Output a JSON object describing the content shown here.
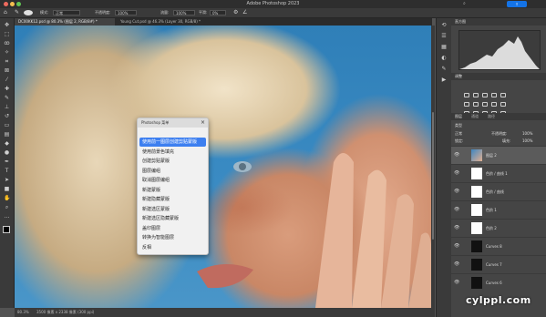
{
  "app": {
    "title": "Adobe Photoshop 2023",
    "traffic_lights": [
      "#ed6a5e",
      "#f5bf4f",
      "#62c554"
    ]
  },
  "options_bar": {
    "mode_label": "模式:",
    "mode_value": "正常",
    "opacity_label": "不透明度:",
    "opacity_value": "100%",
    "flow_label": "流量:",
    "flow_value": "100%",
    "smoothing_label": "平滑:",
    "smoothing_value": "0%"
  },
  "tabs": [
    {
      "label": "DC00KK12.psd @ 80.3% (图层 2, RGB/8#) *",
      "active": true
    },
    {
      "label": "Young Cut.psd @ 46.3% (Layer 30, RGB/8) *",
      "active": false
    }
  ],
  "toolbar": {
    "tools": [
      "move-icon",
      "marquee-icon",
      "lasso-icon",
      "quick-select-icon",
      "crop-icon",
      "frame-icon",
      "eyedropper-icon",
      "healing-icon",
      "brush-icon",
      "stamp-icon",
      "history-brush-icon",
      "eraser-icon",
      "gradient-icon",
      "blur-icon",
      "dodge-icon",
      "pen-icon",
      "type-icon",
      "path-select-icon",
      "shape-icon",
      "hand-icon",
      "zoom-icon",
      "more-icon"
    ]
  },
  "context_menu": {
    "header": "Photoshop 菜单",
    "items": [
      {
        "label": "使用前一图层创建剪贴蒙版",
        "selected": true
      },
      {
        "label": "使用前景色填充",
        "selected": false
      },
      {
        "label": "创建剪贴蒙版",
        "selected": false
      },
      {
        "label": "图层编组",
        "selected": false
      },
      {
        "label": "取消图层编组",
        "selected": false
      },
      {
        "label": "新建蒙版",
        "selected": false
      },
      {
        "label": "新建隐藏蒙版",
        "selected": false
      },
      {
        "label": "新建选区蒙版",
        "selected": false
      },
      {
        "label": "新建选区隐藏蒙版",
        "selected": false
      },
      {
        "label": "盖印图层",
        "selected": false
      },
      {
        "label": "转换为智能图层",
        "selected": false
      },
      {
        "label": "反相",
        "selected": false
      }
    ]
  },
  "status_bar": {
    "zoom": "80.3%",
    "doc_info": "3500 像素 x 2338 像素 (300 ppi)"
  },
  "right_panel": {
    "histogram_tab": "直方图",
    "adjustments_tab": "调整",
    "layers_tab": "图层",
    "channels_tab": "通道",
    "paths_tab": "路径",
    "kind_label": "类型",
    "blend_mode": "正常",
    "opacity_label": "不透明度:",
    "opacity_value": "100%",
    "lock_label": "锁定:",
    "fill_label": "填充:",
    "fill_value": "100%",
    "layers": [
      {
        "name": "图层 2",
        "selected": true
      },
      {
        "name": "色阶 / 曲线 1",
        "selected": false
      },
      {
        "name": "色阶 / 曲线",
        "selected": false
      },
      {
        "name": "色阶 1",
        "selected": false
      },
      {
        "name": "色阶 2",
        "selected": false
      },
      {
        "name": "Curves 8",
        "selected": false
      },
      {
        "name": "Curves 7",
        "selected": false
      },
      {
        "name": "Curves 6",
        "selected": false
      }
    ]
  },
  "watermark": "cylppl.com"
}
